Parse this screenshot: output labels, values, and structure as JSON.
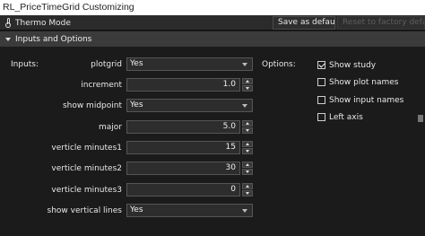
{
  "window": {
    "title": "RL_PriceTimeGrid Customizing"
  },
  "toolbar": {
    "thermo_label": "Thermo Mode",
    "save_default_label": "Save as default",
    "reset_label": "Reset to factory defaults"
  },
  "section": {
    "title": "Inputs and Options"
  },
  "inputs": {
    "group_label": "Inputs:",
    "plotgrid": {
      "label": "plotgrid",
      "value": "Yes"
    },
    "increment": {
      "label": "increment",
      "value": "1.0"
    },
    "show_midpoint": {
      "label": "show midpoint",
      "value": "Yes"
    },
    "major": {
      "label": "major",
      "value": "5.0"
    },
    "verticle_minutes1": {
      "label": "verticle minutes1",
      "value": "15"
    },
    "verticle_minutes2": {
      "label": "verticle minutes2",
      "value": "30"
    },
    "verticle_minutes3": {
      "label": "verticle minutes3",
      "value": "0"
    },
    "show_vertical_lines": {
      "label": "show vertical lines",
      "value": "Yes"
    }
  },
  "options": {
    "group_label": "Options:",
    "items": [
      {
        "label": "Show study",
        "checked": true
      },
      {
        "label": "Show plot names",
        "checked": false
      },
      {
        "label": "Show input names",
        "checked": false
      },
      {
        "label": "Left axis",
        "checked": false
      }
    ]
  }
}
